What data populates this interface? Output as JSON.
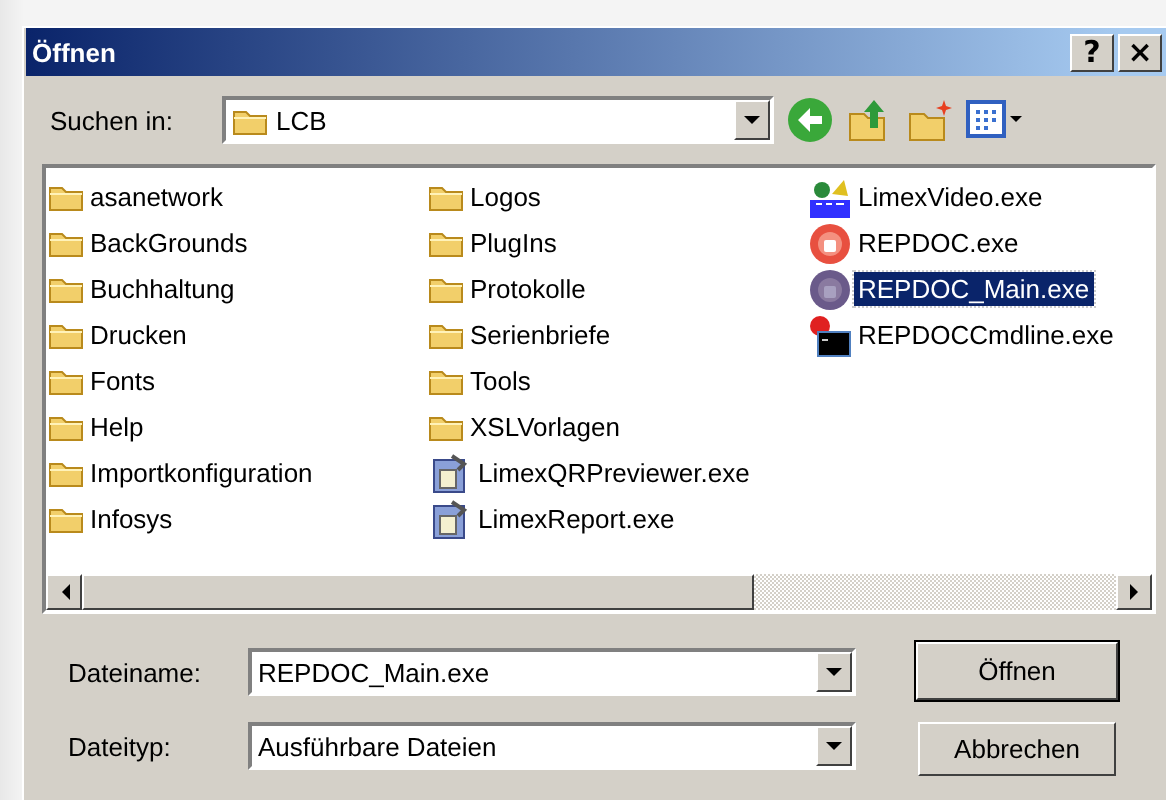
{
  "window": {
    "title": "Öffnen",
    "title_buttons": [
      "?",
      "×"
    ]
  },
  "look_in": {
    "label": "Suchen in:",
    "value": "LCB"
  },
  "files": [
    {
      "name": "asanetwork",
      "kind": "folder",
      "selected": false
    },
    {
      "name": "BackGrounds",
      "kind": "folder",
      "selected": false
    },
    {
      "name": "Buchhaltung",
      "kind": "folder",
      "selected": false
    },
    {
      "name": "Drucken",
      "kind": "folder",
      "selected": false
    },
    {
      "name": "Fonts",
      "kind": "folder",
      "selected": false
    },
    {
      "name": "Help",
      "kind": "folder",
      "selected": false
    },
    {
      "name": "Importkonfiguration",
      "kind": "folder",
      "selected": false
    },
    {
      "name": "Infosys",
      "kind": "folder",
      "selected": false
    },
    {
      "name": "Logos",
      "kind": "folder",
      "selected": false
    },
    {
      "name": "PlugIns",
      "kind": "folder",
      "selected": false
    },
    {
      "name": "Protokolle",
      "kind": "folder",
      "selected": false
    },
    {
      "name": "Serienbriefe",
      "kind": "folder",
      "selected": false
    },
    {
      "name": "Tools",
      "kind": "folder",
      "selected": false
    },
    {
      "name": "XSLVorlagen",
      "kind": "folder",
      "selected": false
    },
    {
      "name": "LimexQRPreviewer.exe",
      "kind": "app",
      "selected": false
    },
    {
      "name": "LimexReport.exe",
      "kind": "app",
      "selected": false
    },
    {
      "name": "LimexVideo.exe",
      "kind": "video",
      "selected": false
    },
    {
      "name": "REPDOC.exe",
      "kind": "disc",
      "selected": false
    },
    {
      "name": "REPDOC_Main.exe",
      "kind": "disc",
      "selected": true
    },
    {
      "name": "REPDOCCmdline.exe",
      "kind": "console",
      "selected": false
    }
  ],
  "file_name": {
    "label": "Dateiname:",
    "value": "REPDOC_Main.exe"
  },
  "file_type": {
    "label": "Dateityp:",
    "value": "Ausführbare Dateien"
  },
  "buttons": [
    {
      "label": "Öffnen",
      "default": true
    },
    {
      "label": "Abbrechen",
      "default": false
    }
  ]
}
